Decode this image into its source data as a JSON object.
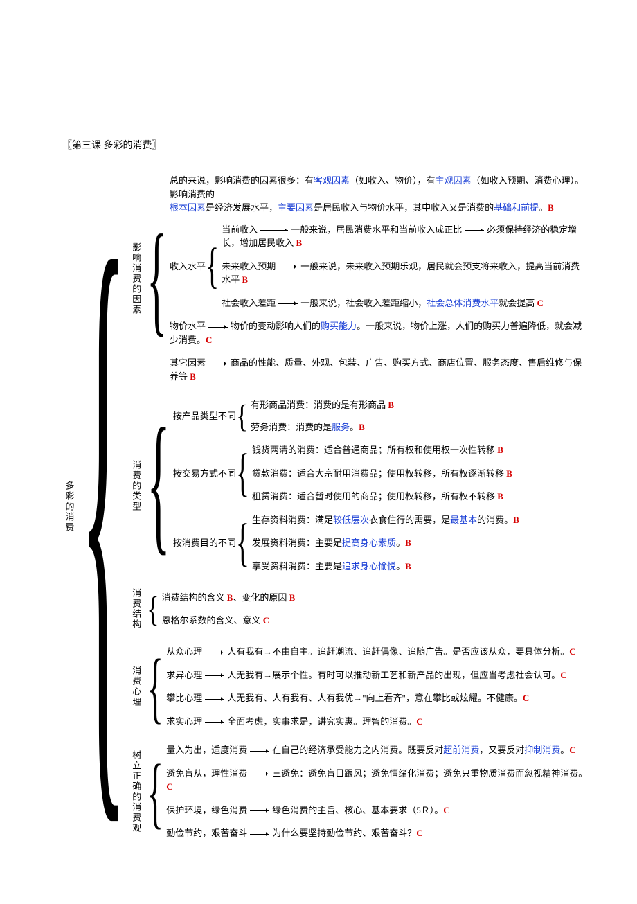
{
  "title": "〖第三课 多彩的消费〗",
  "rootLabel": "多彩的消费",
  "s1": {
    "label": "影响消费的因素",
    "intro1a": "总的来说，影响消费的因素很多：有",
    "intro1b": "客观因素",
    "intro1c": "（如收入、物价），有",
    "intro1d": "主观因素",
    "intro1e": "（如收入预期、消费心理）。影响消费的",
    "intro2a": "根本因素",
    "intro2b": "是经济发展水平，",
    "intro2c": "主要因素",
    "intro2d": "是居民收入与物价水平，其中收入又是消费的",
    "intro2e": "基础和前提",
    "intro2f": "。",
    "income_label": "收入水平",
    "i1a": "当前收入",
    "i1b": "一般来说，居民消费水平和当前收入成正比",
    "i1c": "必须保持经济的稳定增长，增加居民收入 ",
    "i2a": "未来收入预期",
    "i2b": "一般来说，未来收入预期乐观，居民就会预支将来收入，提高当前消费水平 ",
    "i3a": "社会收入差距",
    "i3b": "一般来说，社会收入差距缩小，",
    "i3c": "社会总体消费水平",
    "i3d": "就会提高 ",
    "p1a": "物价水平",
    "p1b": "物价的变动影响人们的",
    "p1c": "购买能力",
    "p1d": "。一般来说，物价上涨，人们的购买力普遍降低，就会减少消费。",
    "o1a": "其它因素",
    "o1b": "商品的性能、质量、外观、包装、广告、购买方式、商店位置、服务态度、售后维修与保养等 "
  },
  "s2": {
    "label": "消费的类型",
    "g1_label": "按产品类型不同",
    "g1_1a": "有形商品消费：消费的是有形商品 ",
    "g1_2a": "劳务消费：消费的是",
    "g1_2b": "服务",
    "g1_2c": "。",
    "g2_label": "按交易方式不同",
    "g2_1": "钱货两清的消费：适合普通商品；所有权和使用权一次性转移 ",
    "g2_2": "贷款消费：适合大宗耐用消费品；使用权转移，所有权逐渐转移 ",
    "g2_3": "租赁消费：适合暂时使用的商品；使用权转移，所有权不转移 ",
    "g3_label": "按消费目的不同",
    "g3_1a": "生存资料消费：满足",
    "g3_1b": "较低层次",
    "g3_1c": "衣食住行的需要，是",
    "g3_1d": "最基本",
    "g3_1e": "的消费。",
    "g3_2a": "发展资料消费：主要是",
    "g3_2b": "提高身心素质",
    "g3_2c": "。",
    "g3_3a": "享受资料消费：主要是",
    "g3_3b": "追求身心愉悦",
    "g3_3c": "。"
  },
  "s3": {
    "label": "消费结构",
    "l1a": "消费结构的含义 ",
    "l1b": "、变化的原因 ",
    "l2": "恩格尔系数的含义、意义 "
  },
  "s4": {
    "label": "消费心理",
    "l1a": "从众心理",
    "l1b": "人有我有→不由自主。追赶潮流、追赶偶像、追随广告。是否应该从众，要具体分析。",
    "l2a": "求异心理",
    "l2b": "人无我有→展示个性。有时可以推动新工艺和新产品的出现，但应当考虑社会认可。",
    "l3a": "攀比心理",
    "l3b": "人无我有、人有我有、人有我优→\"向上看齐\"，意在攀比或炫耀。不健康。",
    "l4a": "求实心理",
    "l4b": "全面考虑，实事求是，讲究实惠。理智的消费。"
  },
  "s5": {
    "label": "树立正确的消费观",
    "l1a": "量入为出，适度消费",
    "l1b": "在自己的经济承受能力之内消费。既要反对",
    "l1c": "超前消费",
    "l1d": "，又要反对",
    "l1e": "抑制消费",
    "l1f": "。",
    "l2a": "避免盲从，理性消费",
    "l2b": "三避免：避免盲目跟风；避免情绪化消费；避免只重物质消费而忽视精神消费。",
    "l3a": "保护环境，绿色消费",
    "l3b": "绿色消费的主旨、核心、基本要求（5Ｒ）。",
    "l4a": "勤俭节约，艰苦奋斗",
    "l4b": "为什么要坚持勤俭节约、艰苦奋斗？"
  },
  "B": "B",
  "C": "C"
}
